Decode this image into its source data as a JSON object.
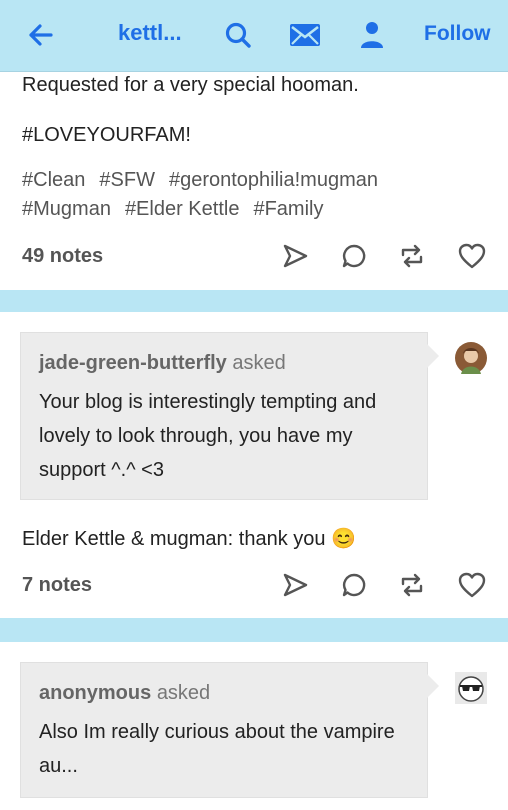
{
  "header": {
    "blog_name": "kettl...",
    "follow_label": "Follow",
    "icons": [
      "back-arrow-icon",
      "search-icon",
      "mail-icon",
      "account-icon"
    ]
  },
  "post1": {
    "line1": "Requested for a very special hooman.",
    "line2": "#LOVEYOURFAM!",
    "tags_row1": [
      "#Clean",
      "#SFW",
      "#gerontophilia!mugman"
    ],
    "tags_row2": [
      "#Mugman",
      "#Elder Kettle",
      "#Family"
    ],
    "notes": "49 notes"
  },
  "post2": {
    "asker": "jade-green-butterfly",
    "asked": "asked",
    "question": "Your blog is interestingly tempting and lovely to look through, you have my support ^.^ <3",
    "answer": "Elder Kettle & mugman: thank you",
    "emoji": "😊",
    "notes": "7 notes"
  },
  "post3": {
    "asker": "anonymous",
    "asked": "asked",
    "question": "Also Im really curious about the vampire au..."
  },
  "colors": {
    "accent": "#1f6fe6",
    "header_bg": "#b9e6f4",
    "ask_bg": "#ececec"
  }
}
